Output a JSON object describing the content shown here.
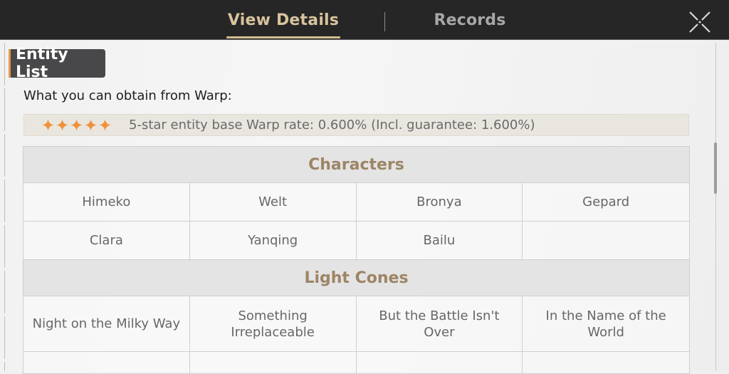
{
  "header": {
    "tabs": [
      {
        "label": "View Details",
        "active": true
      },
      {
        "label": "Records",
        "active": false
      }
    ],
    "close_icon": "close-x-icon"
  },
  "section": {
    "title": "Entity List",
    "intro": "What you can obtain from Warp:",
    "rate": {
      "stars": 5,
      "star_icon": "four-point-star-icon",
      "star_color": "#f0913a",
      "text": "5-star entity base Warp rate: 0.600% (Incl. guarantee: 1.600%)"
    }
  },
  "categories": [
    {
      "title": "Characters",
      "rows": [
        [
          "Himeko",
          "Welt",
          "Bronya",
          "Gepard"
        ],
        [
          "Clara",
          "Yanqing",
          "Bailu",
          ""
        ]
      ]
    },
    {
      "title": "Light Cones",
      "rows": [
        [
          "Night on the Milky Way",
          "Something Irreplaceable",
          "But the Battle Isn't Over",
          "In the Name of the World"
        ]
      ]
    }
  ],
  "colors": {
    "accent_gold": "#d3bd8f",
    "category_title": "#9d8566",
    "tag_accent": "#e8994a"
  }
}
